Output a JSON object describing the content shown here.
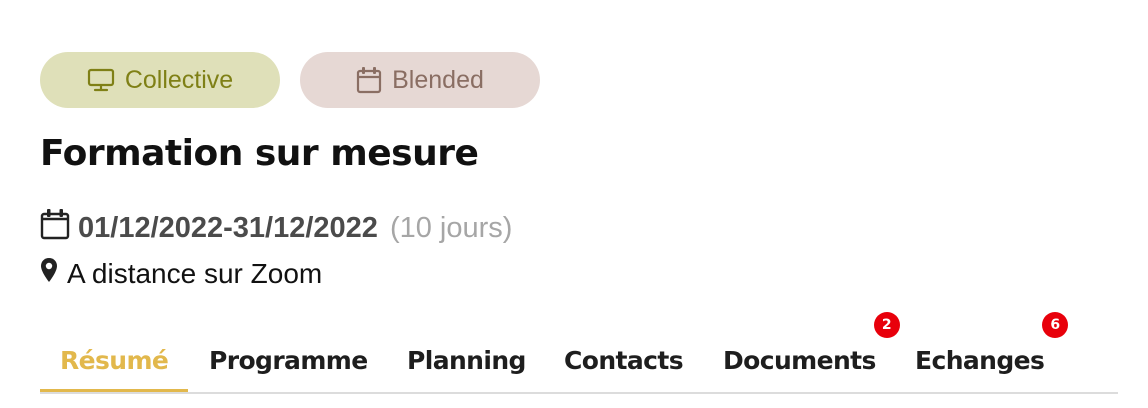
{
  "tags": {
    "collective": {
      "label": "Collective",
      "icon": "monitor-icon",
      "background": "#dfe0b9",
      "color": "#7f8016"
    },
    "blended": {
      "label": "Blended",
      "icon": "calendar-icon",
      "background": "#e6d8d4",
      "color": "#8a6e63"
    }
  },
  "title": "Formation sur mesure",
  "session": {
    "date_range": "01/12/2022-31/12/2022",
    "duration": "(10 jours)",
    "location": "A distance sur Zoom"
  },
  "tabs": [
    {
      "label": "Résumé",
      "active": true
    },
    {
      "label": "Programme"
    },
    {
      "label": "Planning"
    },
    {
      "label": "Contacts"
    },
    {
      "label": "Documents",
      "badge": "2"
    },
    {
      "label": "Echanges",
      "badge": "6"
    }
  ],
  "colors": {
    "accent": "#e2b84c",
    "badge": "#e8000b"
  }
}
